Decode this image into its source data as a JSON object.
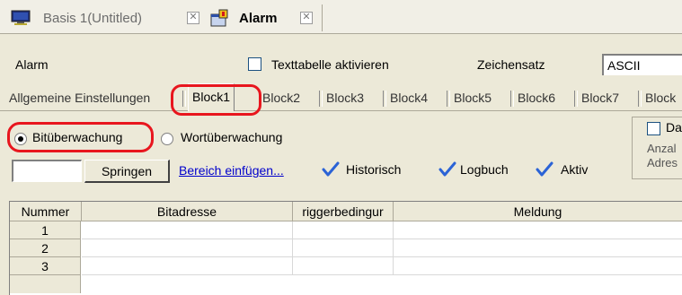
{
  "doc_tabs": [
    {
      "label": "Basis 1(Untitled)",
      "icon": "monitor-screen-icon",
      "active": false
    },
    {
      "label": "Alarm",
      "icon": "alarm-window-icon",
      "active": true
    }
  ],
  "header": {
    "alarm_label": "Alarm",
    "text_table_label": "Texttabelle aktivieren",
    "text_table_checked": false,
    "charset_label": "Zeichensatz",
    "charset_value": "ASCII"
  },
  "block_tabs": [
    {
      "label": "Allgemeine Einstellungen"
    },
    {
      "label": "Block1",
      "active": true
    },
    {
      "label": "Block2"
    },
    {
      "label": "Block3"
    },
    {
      "label": "Block4"
    },
    {
      "label": "Block5"
    },
    {
      "label": "Block6"
    },
    {
      "label": "Block7"
    },
    {
      "label": "Block"
    }
  ],
  "monitoring": {
    "bit_label": "Bitüberwachung",
    "word_label": "Wortüberwachung",
    "selected": "bit"
  },
  "side_group": {
    "title": "Da",
    "line1": "Anzal",
    "line2": "Adres",
    "checked": false
  },
  "toolbar": {
    "jump_value": "",
    "jump_button": "Springen",
    "insert_link": "Bereich einfügen...",
    "historisch": "Historisch",
    "logbuch": "Logbuch",
    "aktiv": "Aktiv"
  },
  "table": {
    "columns": [
      "Nummer",
      "Bitadresse",
      "riggerbedingur",
      "Meldung"
    ],
    "rows": [
      {
        "number": "1",
        "bitaddress": "",
        "trigger": "",
        "message": ""
      },
      {
        "number": "2",
        "bitaddress": "",
        "trigger": "",
        "message": ""
      },
      {
        "number": "3",
        "bitaddress": "",
        "trigger": "",
        "message": ""
      }
    ]
  },
  "colors": {
    "highlight_ring": "#e8161e",
    "link": "#0000cc",
    "checkmark": "#2b63d6",
    "panel": "#ece9d8"
  }
}
